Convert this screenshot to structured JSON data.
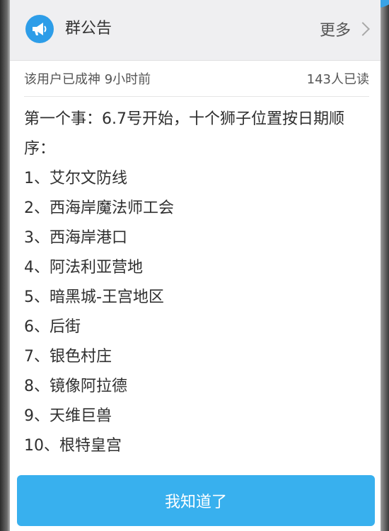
{
  "header": {
    "title": "群公告",
    "more_label": "更多",
    "icon": "megaphone-icon"
  },
  "meta": {
    "author_time": "该用户已成神 9小时前",
    "read_count": "143人已读"
  },
  "announcement": {
    "intro": "第一个事：6.7号开始，十个狮子位置按日期顺序：",
    "items": [
      "1、艾尔文防线",
      "2、西海岸魔法师工会",
      "3、西海岸港口",
      "4、阿法利亚营地",
      "5、暗黑城-王宫地区",
      "6、后街",
      "7、银色村庄",
      "8、镜像阿拉德",
      "9、天维巨兽",
      "10、根特皇宫"
    ]
  },
  "footer": {
    "confirm_label": "我知道了"
  },
  "colors": {
    "accent": "#38b0ee",
    "icon_bg": "#2d9de8",
    "header_bg": "#efeff1"
  }
}
